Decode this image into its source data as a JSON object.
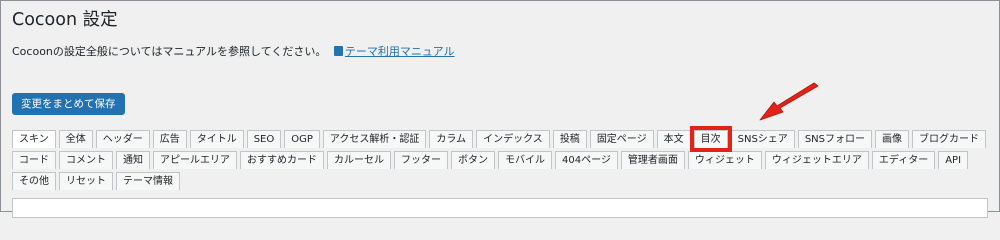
{
  "page": {
    "title": "Cocoon 設定",
    "description": "Cocoonの設定全般についてはマニュアルを参照してください。",
    "manual_link": "テーマ利用マニュアル",
    "save_button": "変更をまとめて保存"
  },
  "tabs": [
    {
      "label": "スキン",
      "active": true
    },
    {
      "label": "全体"
    },
    {
      "label": "ヘッダー"
    },
    {
      "label": "広告"
    },
    {
      "label": "タイトル"
    },
    {
      "label": "SEO"
    },
    {
      "label": "OGP"
    },
    {
      "label": "アクセス解析・認証"
    },
    {
      "label": "カラム"
    },
    {
      "label": "インデックス"
    },
    {
      "label": "投稿"
    },
    {
      "label": "固定ページ"
    },
    {
      "label": "本文"
    },
    {
      "label": "目次",
      "highlighted": true
    },
    {
      "label": "SNSシェア"
    },
    {
      "label": "SNSフォロー"
    },
    {
      "label": "画像"
    },
    {
      "label": "ブログカード"
    },
    {
      "label": "コード"
    },
    {
      "label": "コメント"
    },
    {
      "label": "通知"
    },
    {
      "label": "アピールエリア"
    },
    {
      "label": "おすすめカード"
    },
    {
      "label": "カルーセル"
    },
    {
      "label": "フッター"
    },
    {
      "label": "ボタン"
    },
    {
      "label": "モバイル"
    },
    {
      "label": "404ページ"
    },
    {
      "label": "管理者画面"
    },
    {
      "label": "ウィジェット"
    },
    {
      "label": "ウィジェットエリア"
    },
    {
      "label": "エディター"
    },
    {
      "label": "API"
    },
    {
      "label": "その他"
    },
    {
      "label": "リセット"
    },
    {
      "label": "テーマ情報"
    }
  ],
  "colors": {
    "accent": "#2271b1",
    "highlight": "#e2231a",
    "background": "#f0f0f1"
  },
  "icons": {
    "manual": "book-icon",
    "annotation": "red-arrow-icon"
  }
}
